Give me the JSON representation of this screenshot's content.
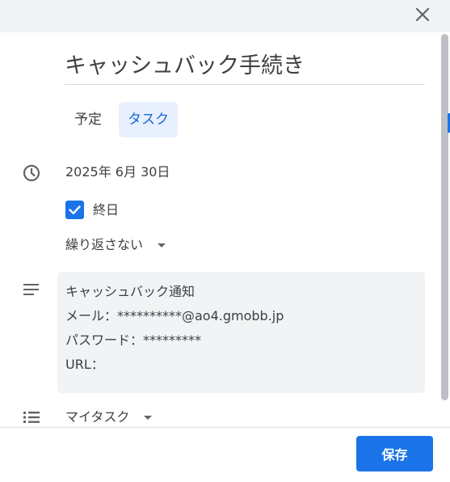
{
  "dialog": {
    "title": "キャッシュバック手続き",
    "tabs": [
      {
        "label": "予定",
        "selected": false
      },
      {
        "label": "タスク",
        "selected": true
      }
    ],
    "date": "2025年 6月 30日",
    "all_day": {
      "label": "終日",
      "checked": true
    },
    "repeat": "繰り返さない",
    "description_lines": [
      "キャッシュバック通知",
      "メール：**********@ao4.gmobb.jp",
      "パスワード：*********",
      "URL："
    ],
    "task_list": "マイタスク",
    "save_label": "保存"
  },
  "icons": {
    "close": "close-icon",
    "clock": "clock-icon",
    "description": "notes-icon",
    "list": "list-icon",
    "dropdown": "caret-down-icon",
    "check": "check-icon"
  },
  "colors": {
    "accent": "#1a73e8",
    "selected_tab_bg": "#e8f0fe",
    "selected_tab_text": "#1967d2",
    "field_bg": "#f1f3f4"
  }
}
